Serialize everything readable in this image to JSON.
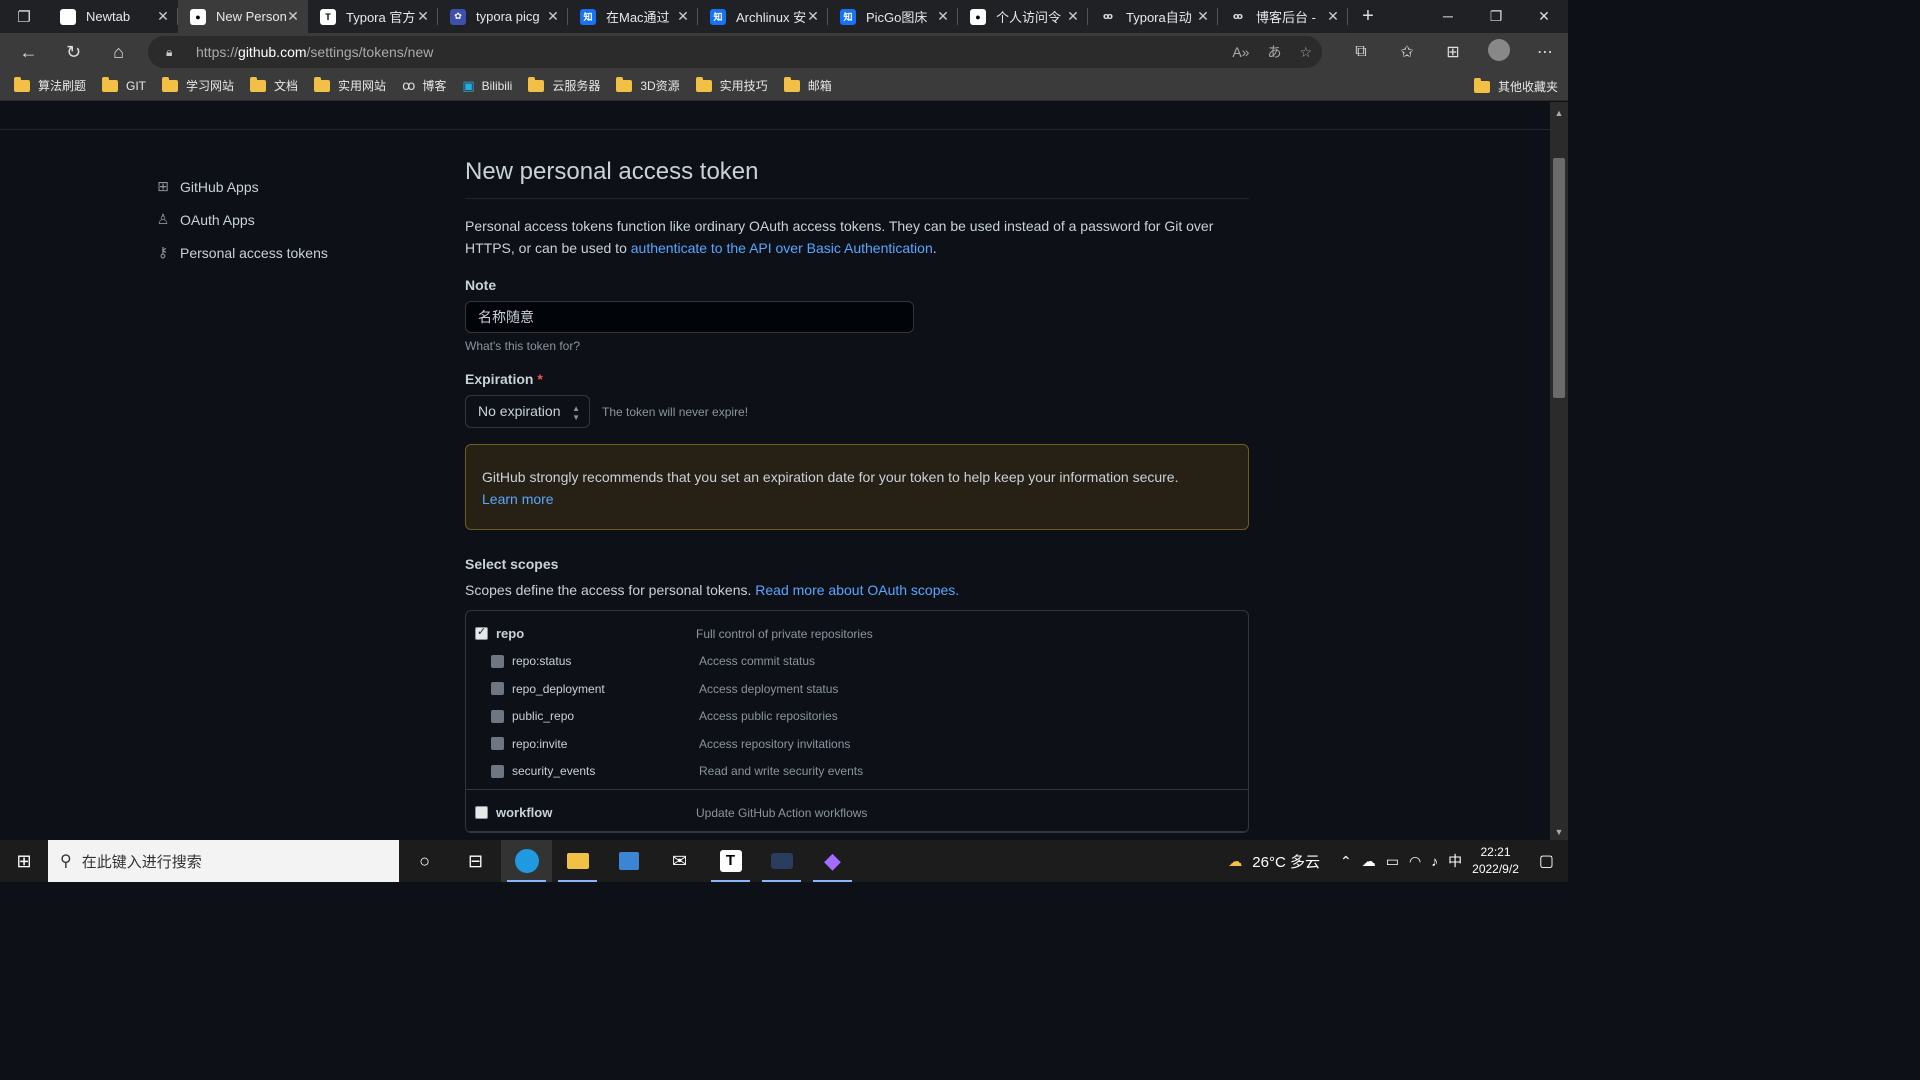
{
  "tabs": [
    {
      "title": "Newtab",
      "icon": "page-icon",
      "active": false
    },
    {
      "title": "New Person",
      "icon": "github-icon",
      "active": true
    },
    {
      "title": "Typora 官方",
      "icon": "typora-icon",
      "active": false
    },
    {
      "title": "typora picg",
      "icon": "picgo-icon",
      "active": false
    },
    {
      "title": "在Mac通过",
      "icon": "zhihu-icon",
      "active": false
    },
    {
      "title": "Archlinux 安",
      "icon": "zhihu-icon",
      "active": false
    },
    {
      "title": "PicGo图床",
      "icon": "zhihu-icon",
      "active": false
    },
    {
      "title": "个人访问令",
      "icon": "github-icon",
      "active": false
    },
    {
      "title": "Typora自动",
      "icon": "blog-icon",
      "active": false
    },
    {
      "title": "博客后台 -",
      "icon": "blog-icon",
      "active": false
    }
  ],
  "address": {
    "prefix": "https://",
    "host": "github.com",
    "path": "/settings/tokens/new"
  },
  "bookmarks": [
    {
      "label": "算法刷题",
      "icon": "folder-icon"
    },
    {
      "label": "GIT",
      "icon": "folder-icon"
    },
    {
      "label": "学习网站",
      "icon": "folder-icon"
    },
    {
      "label": "文档",
      "icon": "folder-icon"
    },
    {
      "label": "实用网站",
      "icon": "folder-icon"
    },
    {
      "label": "博客",
      "icon": "blog-icon"
    },
    {
      "label": "Bilibili",
      "icon": "bilibili-icon"
    },
    {
      "label": "云服务器",
      "icon": "folder-icon"
    },
    {
      "label": "3D资源",
      "icon": "folder-icon"
    },
    {
      "label": "实用技巧",
      "icon": "folder-icon"
    },
    {
      "label": "邮箱",
      "icon": "folder-icon"
    }
  ],
  "bookmarks_other": "其他收藏夹",
  "sidebar": {
    "items": [
      {
        "label": "GitHub Apps",
        "icon": "apps-grid-icon"
      },
      {
        "label": "OAuth Apps",
        "icon": "person-icon"
      },
      {
        "label": "Personal access tokens",
        "icon": "key-icon"
      }
    ]
  },
  "main": {
    "title": "New personal access token",
    "desc_text": "Personal access tokens function like ordinary OAuth access tokens. They can be used instead of a password for Git over HTTPS, or can be used to ",
    "desc_link": "authenticate to the API over Basic Authentication",
    "desc_end": ".",
    "note_label": "Note",
    "note_value": "名称随意",
    "note_hint": "What's this token for?",
    "expiration_label": "Expiration",
    "expiration_required": "*",
    "expiration_value": "No expiration",
    "expiration_hint": "The token will never expire!",
    "warning_text": "GitHub strongly recommends that you set an expiration date for your token to help keep your information secure.",
    "warning_link": "Learn more",
    "scopes_title": "Select scopes",
    "scopes_desc": "Scopes define the access for personal tokens. ",
    "scopes_link": "Read more about OAuth scopes."
  },
  "scopes": [
    {
      "name": "repo",
      "desc": "Full control of private repositories",
      "checked": true,
      "children": [
        {
          "name": "repo:status",
          "desc": "Access commit status"
        },
        {
          "name": "repo_deployment",
          "desc": "Access deployment status"
        },
        {
          "name": "public_repo",
          "desc": "Access public repositories"
        },
        {
          "name": "repo:invite",
          "desc": "Access repository invitations"
        },
        {
          "name": "security_events",
          "desc": "Read and write security events"
        }
      ]
    },
    {
      "name": "workflow",
      "desc": "Update GitHub Action workflows",
      "checked": false,
      "children": []
    }
  ],
  "taskbar": {
    "search_placeholder": "在此键入进行搜索",
    "weather": "26°C 多云",
    "ime": "中",
    "time": "22:21",
    "date": "2022/9/2"
  },
  "colors": {
    "accent": "#58a6ff",
    "bg": "#0d1117",
    "warning_bg": "#272115",
    "warning_border": "#6e5b20"
  }
}
